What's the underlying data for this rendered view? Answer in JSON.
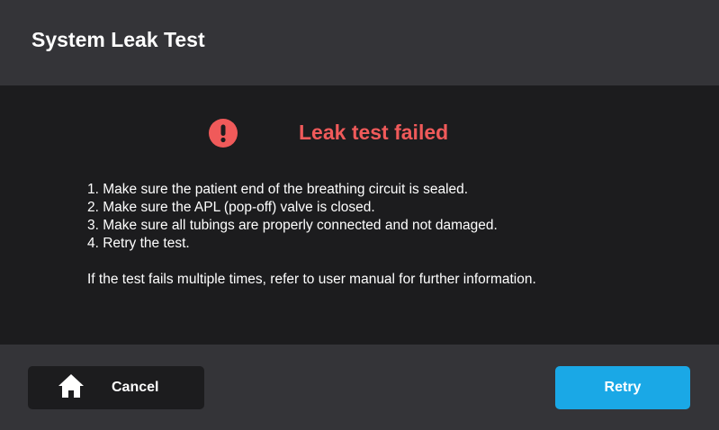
{
  "header": {
    "title": "System Leak Test"
  },
  "alert": {
    "icon": "exclamation-circle-icon",
    "title": "Leak test failed",
    "color": "#f05a5a"
  },
  "instructions": {
    "steps": [
      "1. Make sure the patient end of the breathing circuit is sealed.",
      "2. Make sure the APL (pop-off) valve is closed.",
      "3. Make sure all tubings are properly connected and not damaged.",
      "4. Retry the test."
    ],
    "note": "If the test fails multiple times, refer to user manual for further information."
  },
  "footer": {
    "cancel": {
      "icon": "home-icon",
      "label": "Cancel"
    },
    "retry": {
      "label": "Retry",
      "color": "#1aa8e6"
    }
  }
}
